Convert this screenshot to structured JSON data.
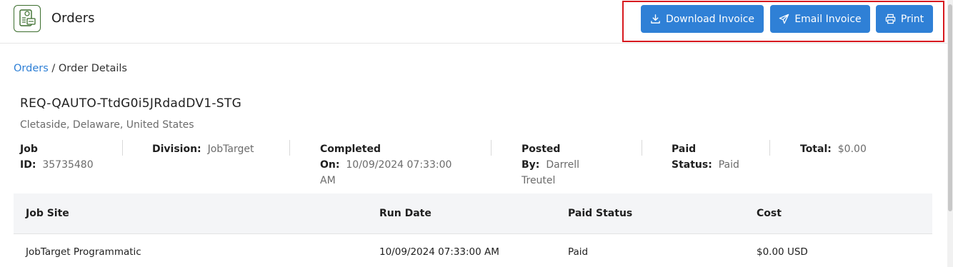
{
  "header": {
    "title": "Orders",
    "app_icon": "invoice-icon",
    "actions": {
      "download_label": "Download Invoice",
      "email_label": "Email Invoice",
      "print_label": "Print"
    }
  },
  "breadcrumb": {
    "link": "Orders",
    "separator": " / ",
    "current": "Order Details"
  },
  "order": {
    "id": "REQ-QAUTO-TtdG0i5JRdadDV1-STG",
    "location": "Cletaside, Delaware, United States",
    "meta": {
      "job_id_label_1": "Job",
      "job_id_label_2": "ID:",
      "job_id_value": "35735480",
      "division_label": "Division:",
      "division_value": "JobTarget",
      "completed_label_1": "Completed",
      "completed_label_2": "On:",
      "completed_value_1": "10/09/2024 07:33:00",
      "completed_value_2": "AM",
      "posted_label_1": "Posted",
      "posted_label_2": "By:",
      "posted_value_1": "Darrell",
      "posted_value_2": "Treutel",
      "paid_label_1": "Paid",
      "paid_label_2": "Status:",
      "paid_value": "Paid",
      "total_label": "Total:",
      "total_value": "$0.00"
    }
  },
  "table": {
    "headers": [
      "Job Site",
      "Run Date",
      "Paid Status",
      "Cost"
    ],
    "rows": [
      [
        "JobTarget Programmatic",
        "10/09/2024 07:33:00 AM",
        "Paid",
        "$0.00 USD"
      ]
    ]
  },
  "colors": {
    "primary": "#2f80d6",
    "highlight_frame": "#d7191f",
    "icon_green": "#3c6e2e"
  }
}
